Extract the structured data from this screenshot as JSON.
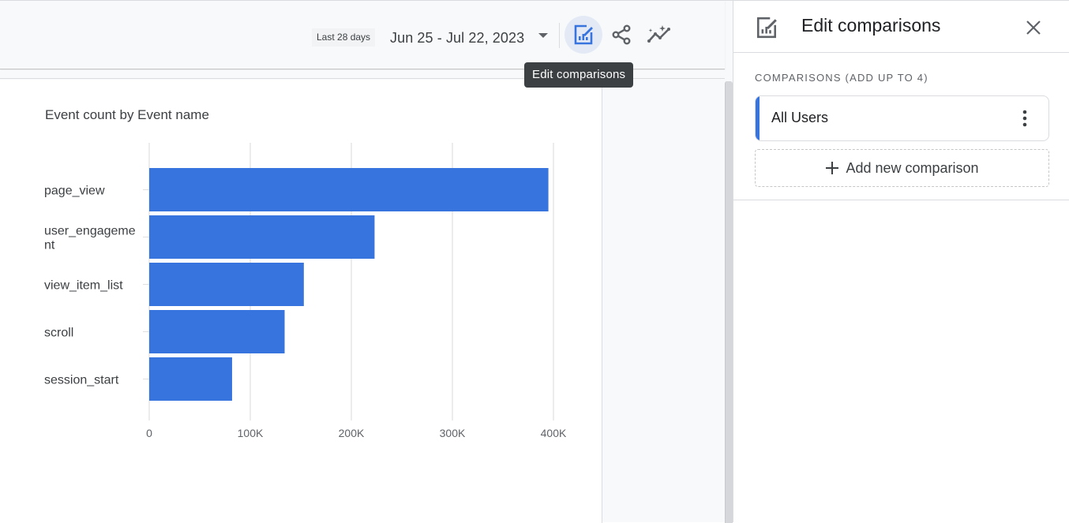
{
  "header": {
    "date_preset": "Last 28 days",
    "date_range": "Jun 25 - Jul 22, 2023",
    "actions": [
      {
        "name": "edit-comparisons",
        "icon": "edit-comparisons-icon",
        "active": true
      },
      {
        "name": "share",
        "icon": "share-icon",
        "active": false
      },
      {
        "name": "insights",
        "icon": "insights-icon",
        "active": false
      }
    ],
    "tooltip": "Edit comparisons"
  },
  "side_panel": {
    "title": "Edit comparisons",
    "section_label": "COMPARISONS (ADD UP TO 4)",
    "comparisons": [
      {
        "label": "All Users",
        "color": "#3874de"
      }
    ],
    "add_label": "Add new comparison"
  },
  "chart_data": {
    "type": "bar",
    "orientation": "horizontal",
    "title": "Event count by Event name",
    "categories": [
      "page_view",
      "user_engagement",
      "view_item_list",
      "scroll",
      "session_start"
    ],
    "category_labels": [
      [
        "page_view"
      ],
      [
        "user_engageme",
        "nt"
      ],
      [
        "view_item_list"
      ],
      [
        "scroll"
      ],
      [
        "session_start"
      ]
    ],
    "values": [
      395000,
      223000,
      153000,
      134000,
      82000
    ],
    "xlabel": "",
    "ylabel": "",
    "xlim": [
      0,
      400000
    ],
    "x_ticks": [
      0,
      100000,
      200000,
      300000,
      400000
    ],
    "x_tick_labels": [
      "0",
      "100K",
      "200K",
      "300K",
      "400K"
    ],
    "grid": true,
    "bar_color": "#3874de",
    "legend": "none"
  }
}
